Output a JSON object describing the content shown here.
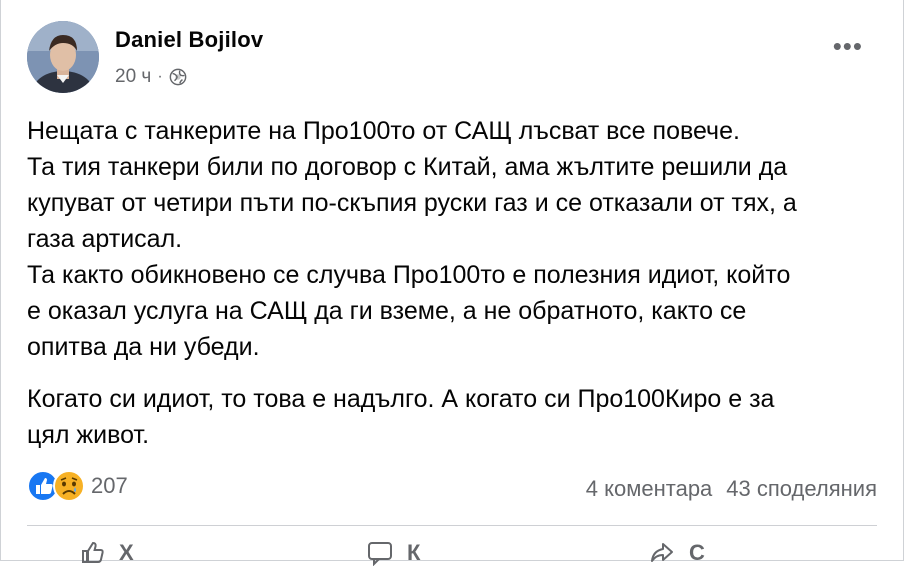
{
  "post": {
    "author": "Daniel Bojilov",
    "time": "20 ч",
    "separator": "·",
    "privacy_icon": "globe-icon",
    "more_label": "•••",
    "paragraphs": [
      {
        "lines": [
          "Нещата с танкерите на Про100то от САЩ лъсват все повече.",
          "Та тия танкери били по договор с Китай, ама жълтите решили да",
          "купуват от четири пъти по-скъпия руски газ и се отказали от тях, а",
          "газа артисал.",
          "Та както обикновено се случва Про100то е полезния идиот, който",
          "е оказал услуга на САЩ да ги вземе, а не обратното, както се",
          "опитва да ни убеди."
        ]
      },
      {
        "lines": [
          "Когато си идиот, то това е надълго. А когато си Про100Киро е за",
          "цял живот."
        ]
      }
    ]
  },
  "reactions": {
    "icons": [
      "like-icon",
      "sad-icon"
    ],
    "count": "207",
    "comments": "4 коментара",
    "shares": "43 споделяния"
  },
  "actions": {
    "like_label": "Х",
    "comment_label": "К",
    "share_label": "С"
  },
  "colors": {
    "like_blue": "#1877f2",
    "sad_yellow": "#f7b125",
    "secondary_text": "#65676b",
    "primary_text": "#050505"
  }
}
